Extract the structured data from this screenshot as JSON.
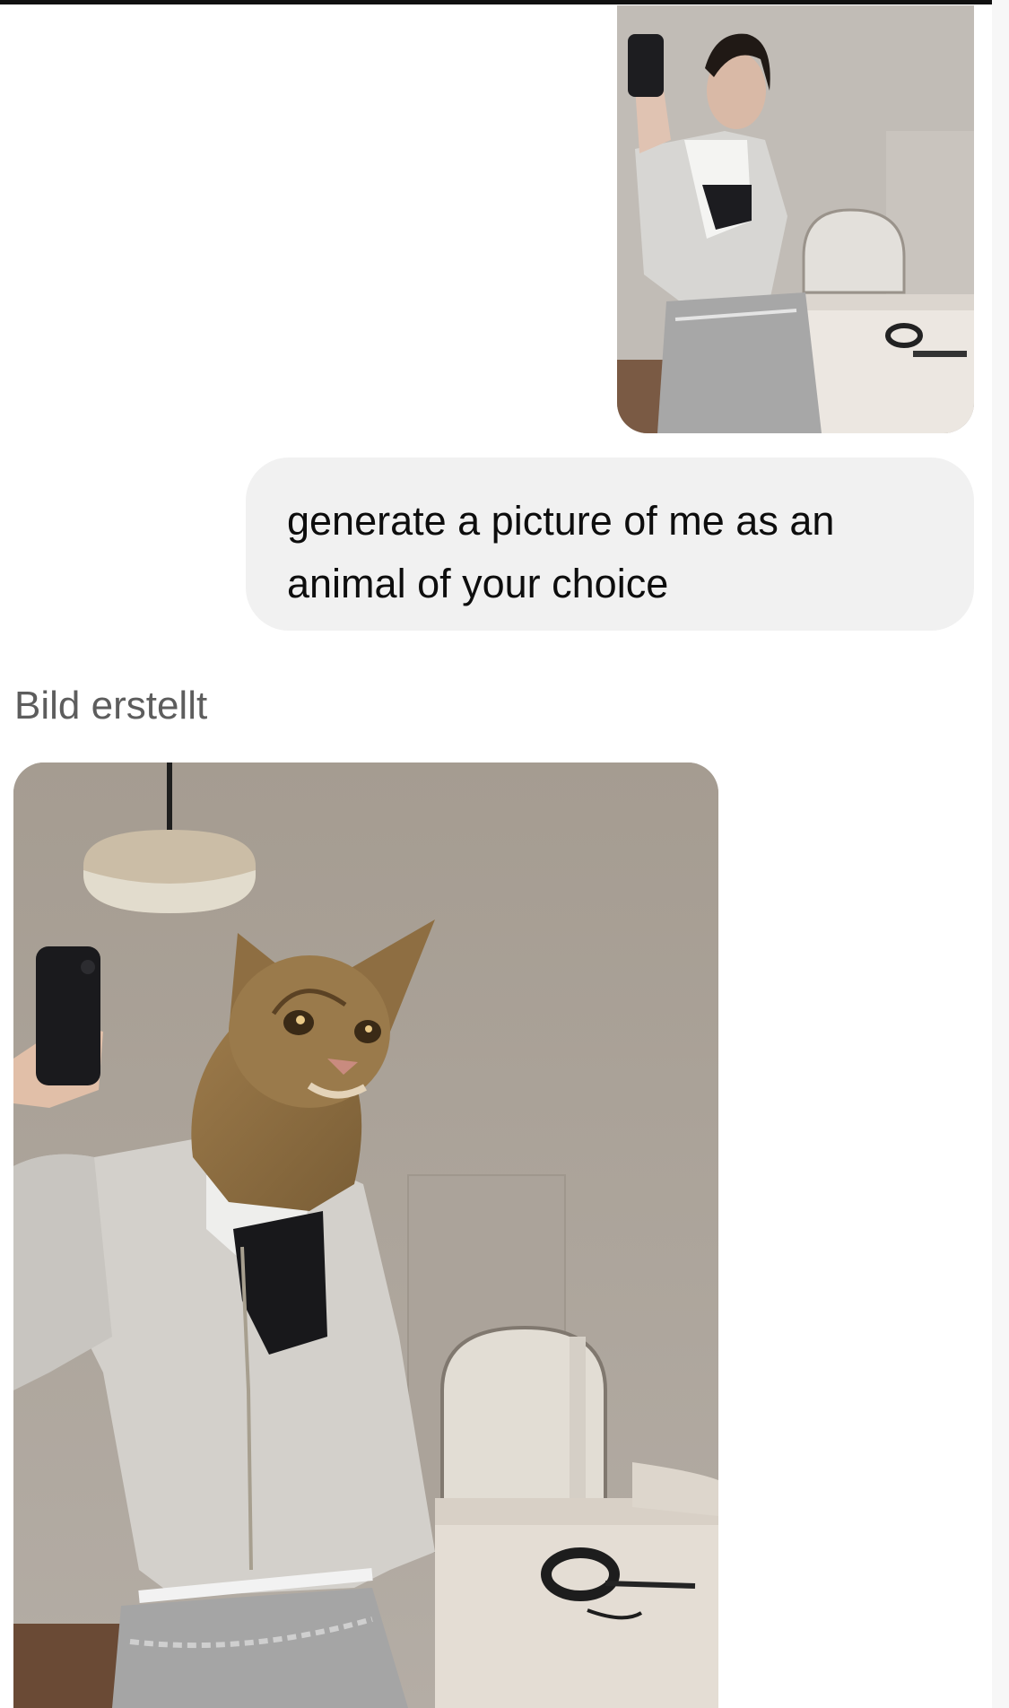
{
  "conversation": {
    "user_message": "generate a picture of me as an animal of your choice",
    "assistant_status": "Bild erstellt"
  },
  "images": {
    "user_photo": {
      "description_icon": "photo-icon",
      "subject": "mirror-selfie"
    },
    "generated": {
      "description_icon": "photo-icon",
      "subject": "cat-mirror-selfie"
    }
  },
  "colors": {
    "user_bubble": "#f1f1f1",
    "status_text": "#5d5d5d",
    "message_text": "#0d0d0d"
  }
}
